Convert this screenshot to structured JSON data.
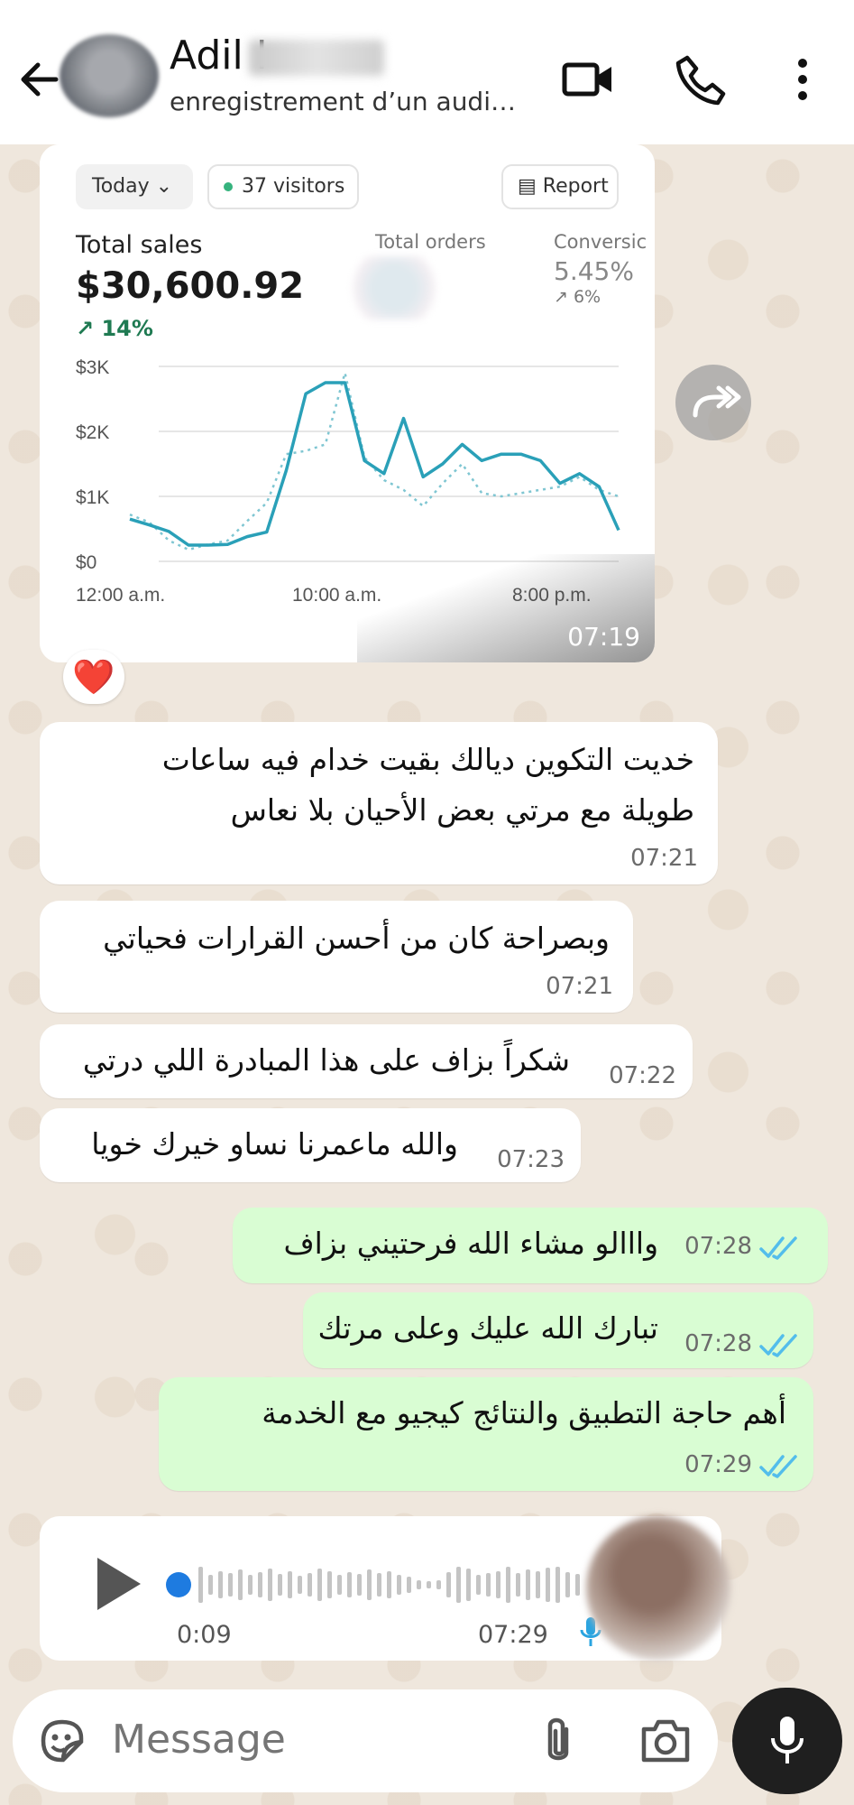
{
  "header": {
    "contact_name": "Adil I",
    "status": "enregistrement d’un audi…",
    "icons": [
      "back-arrow-icon",
      "video-call-icon",
      "phone-call-icon",
      "more-options-icon"
    ]
  },
  "image_message": {
    "time": "07:19",
    "reaction": "❤️",
    "dashboard": {
      "filter": "Today",
      "visitors": "37 visitors",
      "report": "Report",
      "total_sales_label": "Total sales",
      "total_sales_value": "$30,600.92",
      "total_sales_change": "↗ 14%",
      "total_orders_label": "Total orders",
      "conversion_label": "Conversic",
      "conversion_value": "5.45%",
      "conversion_change": "↗ 6%"
    }
  },
  "chart_data": {
    "type": "line",
    "ylabel": "",
    "xlabel": "",
    "y_ticks": [
      "$3K",
      "$2K",
      "$1K",
      "$0"
    ],
    "x_ticks": [
      "12:00 a.m.",
      "10:00 a.m.",
      "8:00 p.m."
    ],
    "ylim": [
      0,
      3000
    ],
    "grid": true,
    "series": [
      {
        "style": "solid",
        "color": "#2aa0b8",
        "values": [
          650,
          560,
          460,
          250,
          250,
          260,
          380,
          450,
          1400,
          2580,
          2750,
          2750,
          1550,
          1350,
          2200,
          1300,
          1500,
          1800,
          1550,
          1650,
          1650,
          1550,
          1200,
          1350,
          1150,
          480
        ]
      },
      {
        "style": "dotted",
        "color": "#7fc6d2",
        "values": [
          720,
          600,
          320,
          180,
          260,
          320,
          620,
          900,
          1650,
          1700,
          1800,
          2900,
          1600,
          1250,
          1100,
          850,
          1200,
          1500,
          1050,
          1000,
          1050,
          1100,
          1150,
          1300,
          1100,
          1000
        ]
      }
    ]
  },
  "messages": [
    {
      "dir": "in",
      "lines": [
        "خديت التكوين ديالك بقيت خدام فيه ساعات",
        "طويلة مع مرتي بعض الأحيان بلا نعاس"
      ],
      "time": "07:21"
    },
    {
      "dir": "in",
      "lines": [
        "وبصراحة كان من أحسن القرارات فحياتي"
      ],
      "time": "07:21"
    },
    {
      "dir": "in",
      "lines": [
        "شكراً بزاف على هذا المبادرة اللي درتي"
      ],
      "time": "07:22"
    },
    {
      "dir": "in",
      "lines": [
        "والله ماعمرنا نساو خيرك خويا"
      ],
      "time": "07:23"
    },
    {
      "dir": "out",
      "lines": [
        "وااالو مشاء الله فرحتيني بزاف"
      ],
      "time": "07:28"
    },
    {
      "dir": "out",
      "lines": [
        "تبارك الله عليك وعلى مرتك"
      ],
      "time": "07:28"
    },
    {
      "dir": "out",
      "lines": [
        "أهم حاجة التطبيق والنتائج كيجيو مع الخدمة"
      ],
      "time": "07:29"
    }
  ],
  "audio_message": {
    "duration": "0:09",
    "time": "07:29",
    "progress": 0
  },
  "input": {
    "placeholder": "Message"
  },
  "colors": {
    "outgoing": "#d9fdd3",
    "incoming": "#ffffff",
    "read_ticks": "#53bdeb",
    "heart": "#e0253a"
  }
}
